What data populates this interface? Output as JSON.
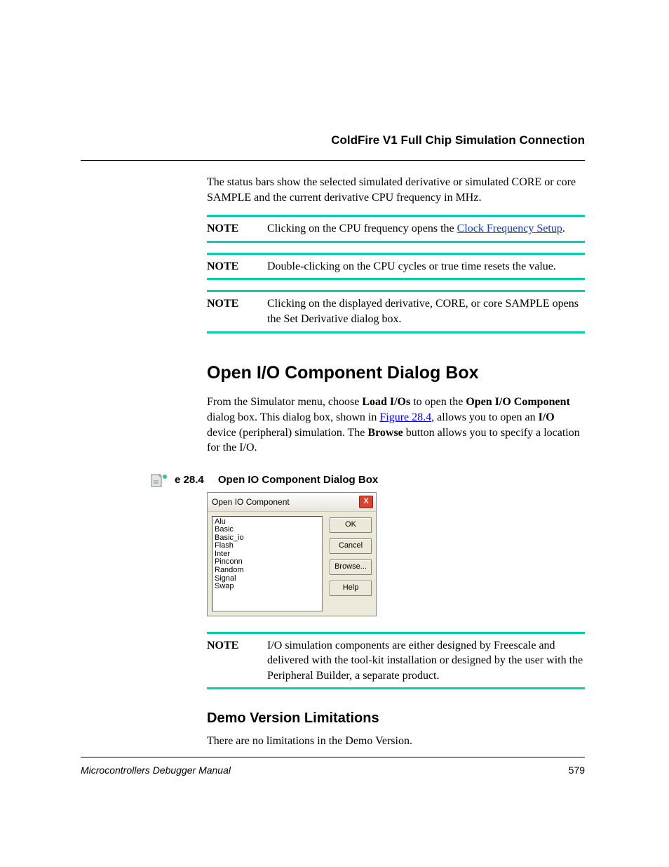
{
  "running_head": "ColdFire V1 Full Chip Simulation Connection",
  "intro": "The status bars show the selected simulated derivative or simulated CORE or core SAMPLE and the current derivative CPU frequency in MHz.",
  "notes": [
    {
      "label": "NOTE",
      "pre": "Clicking on the CPU frequency opens the ",
      "link": "Clock Frequency Setup",
      "post": "."
    },
    {
      "label": "NOTE",
      "text": "Double-clicking on the CPU cycles or true time resets the value."
    },
    {
      "label": "NOTE",
      "text": "Clicking on the displayed derivative, CORE, or core SAMPLE opens the Set Derivative dialog box."
    }
  ],
  "h1": "Open I/O Component Dialog Box",
  "open_para": {
    "p1a": "From the Simulator menu, choose ",
    "b1": "Load I/Os",
    "p1b": " to open the ",
    "b2": "Open I/O Component",
    "p1c": " dialog box. This dialog box, shown in ",
    "link": "Figure 28.4",
    "p1d": ", allows you to open an ",
    "b3": "I/O",
    "p1e": " device (peripheral) simulation. The ",
    "b4": "Browse",
    "p1f": " button allows you to specify a location for the I/O."
  },
  "figure": {
    "caption_prefix": "e 28.4",
    "caption_title": "Open IO Component Dialog Box",
    "dialog_title": "Open IO Component",
    "list_items": [
      "Alu",
      "Basic",
      "Basic_io",
      "Flash",
      "Inter",
      "Pinconn",
      "Random",
      "Signal",
      "Swap"
    ],
    "buttons": {
      "ok": "OK",
      "cancel": "Cancel",
      "browse": "Browse...",
      "help": "Help"
    },
    "close": "X"
  },
  "note_after": {
    "label": "NOTE",
    "text": "I/O simulation components are either designed by Freescale and delivered with the tool-kit installation or designed by the user with the Peripheral Builder, a separate product."
  },
  "h2": "Demo Version Limitations",
  "demo_text": "There are no limitations in the Demo Version.",
  "footer": {
    "title": "Microcontrollers Debugger Manual",
    "page": "579"
  }
}
